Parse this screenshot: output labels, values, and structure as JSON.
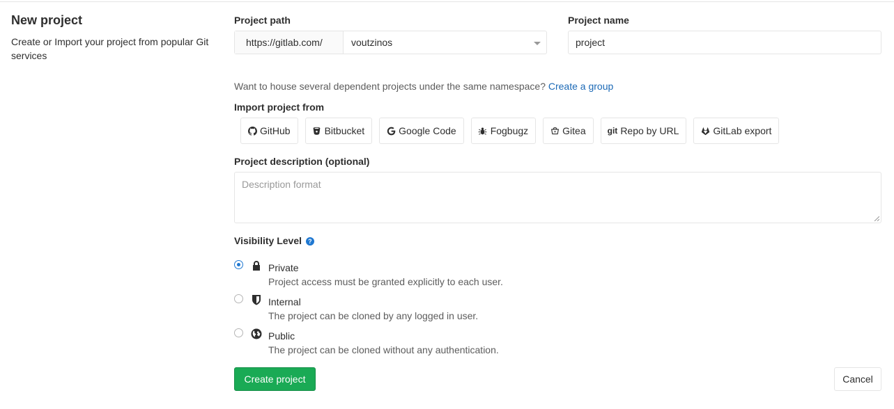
{
  "sidebar": {
    "title": "New project",
    "description": "Create or Import your project from popular Git services"
  },
  "project_path": {
    "label": "Project path",
    "prefix": "https://gitlab.com/",
    "namespace": "voutzinos"
  },
  "project_name": {
    "label": "Project name",
    "value": "project"
  },
  "namespace_hint": {
    "text": "Want to house several dependent projects under the same namespace?",
    "link": "Create a group"
  },
  "import": {
    "label": "Import project from",
    "sources": [
      {
        "label": "GitHub",
        "icon": "github-icon"
      },
      {
        "label": "Bitbucket",
        "icon": "bitbucket-icon"
      },
      {
        "label": "Google Code",
        "icon": "google-icon"
      },
      {
        "label": "Fogbugz",
        "icon": "bug-icon"
      },
      {
        "label": "Gitea",
        "icon": "gitea-icon"
      },
      {
        "label": "Repo by URL",
        "icon": "git-icon"
      },
      {
        "label": "GitLab export",
        "icon": "gitlab-icon"
      }
    ]
  },
  "description": {
    "label": "Project description (optional)",
    "placeholder": "Description format"
  },
  "visibility": {
    "label": "Visibility Level",
    "help": "?",
    "options": [
      {
        "title": "Private",
        "description": "Project access must be granted explicitly to each user.",
        "icon": "lock-icon",
        "selected": true
      },
      {
        "title": "Internal",
        "description": "The project can be cloned by any logged in user.",
        "icon": "shield-icon",
        "selected": false
      },
      {
        "title": "Public",
        "description": "The project can be cloned without any authentication.",
        "icon": "globe-icon",
        "selected": false
      }
    ]
  },
  "actions": {
    "create": "Create project",
    "cancel": "Cancel"
  },
  "colors": {
    "primary": "#1aaa55",
    "link": "#1b69b6",
    "radio_selected": "#1f78d1"
  }
}
